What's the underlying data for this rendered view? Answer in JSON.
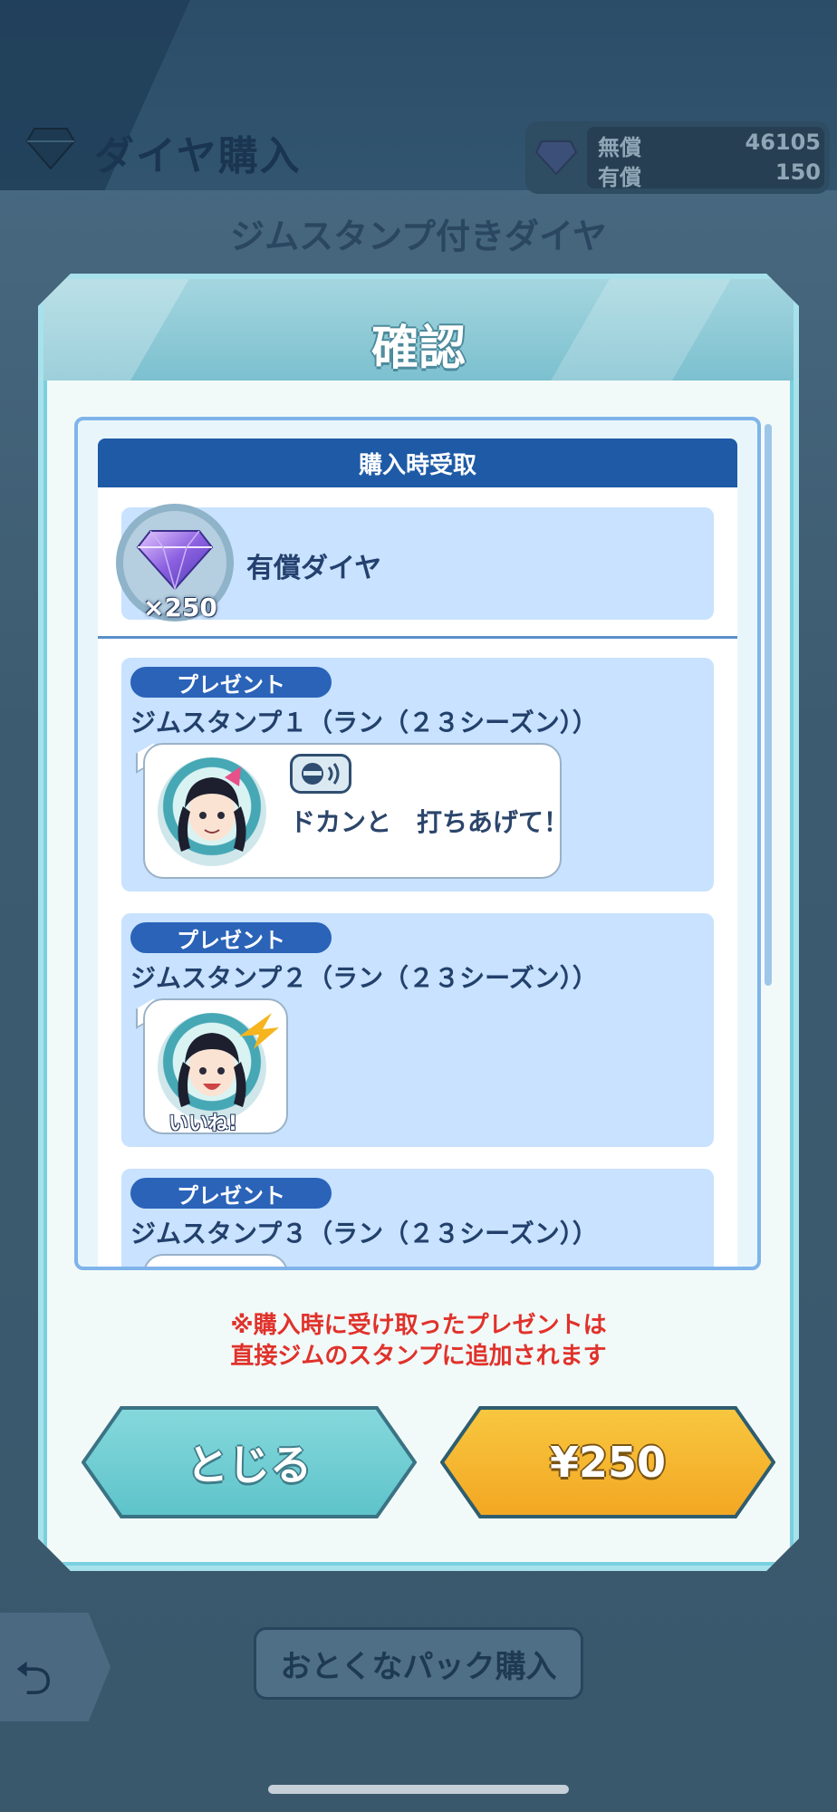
{
  "background": {
    "title": "ダイヤ購入",
    "currency": {
      "free_label": "無償",
      "free_value": "46105",
      "paid_label": "有償",
      "paid_value": "150"
    },
    "subtitle": "ジムスタンプ付きダイヤ",
    "pack_button": "おとくなパック購入"
  },
  "dialog": {
    "title": "確認",
    "section_header": "購入時受取",
    "item": {
      "count": "×250",
      "name": "有償ダイヤ"
    },
    "presents": [
      {
        "badge": "プレゼント",
        "title": "ジムスタンプ１（ラン（２３シーズン））",
        "chat_text": "ドカンと　打ちあげて！"
      },
      {
        "badge": "プレゼント",
        "title": "ジムスタンプ２（ラン（２３シーズン））",
        "stamp_text": "いいね!"
      },
      {
        "badge": "プレゼント",
        "title": "ジムスタンプ３（ラン（２３シーズン））"
      }
    ],
    "notice_line1": "※購入時に受け取ったプレゼントは",
    "notice_line2": "直接ジムのスタンプに追加されます",
    "close_button": "とじる",
    "buy_button": "¥250"
  },
  "colors": {
    "header_blue": "#1e5aa6",
    "notice_red": "#e0322b",
    "close_teal": "#5dc3ca",
    "buy_yellow": "#f3a622"
  }
}
